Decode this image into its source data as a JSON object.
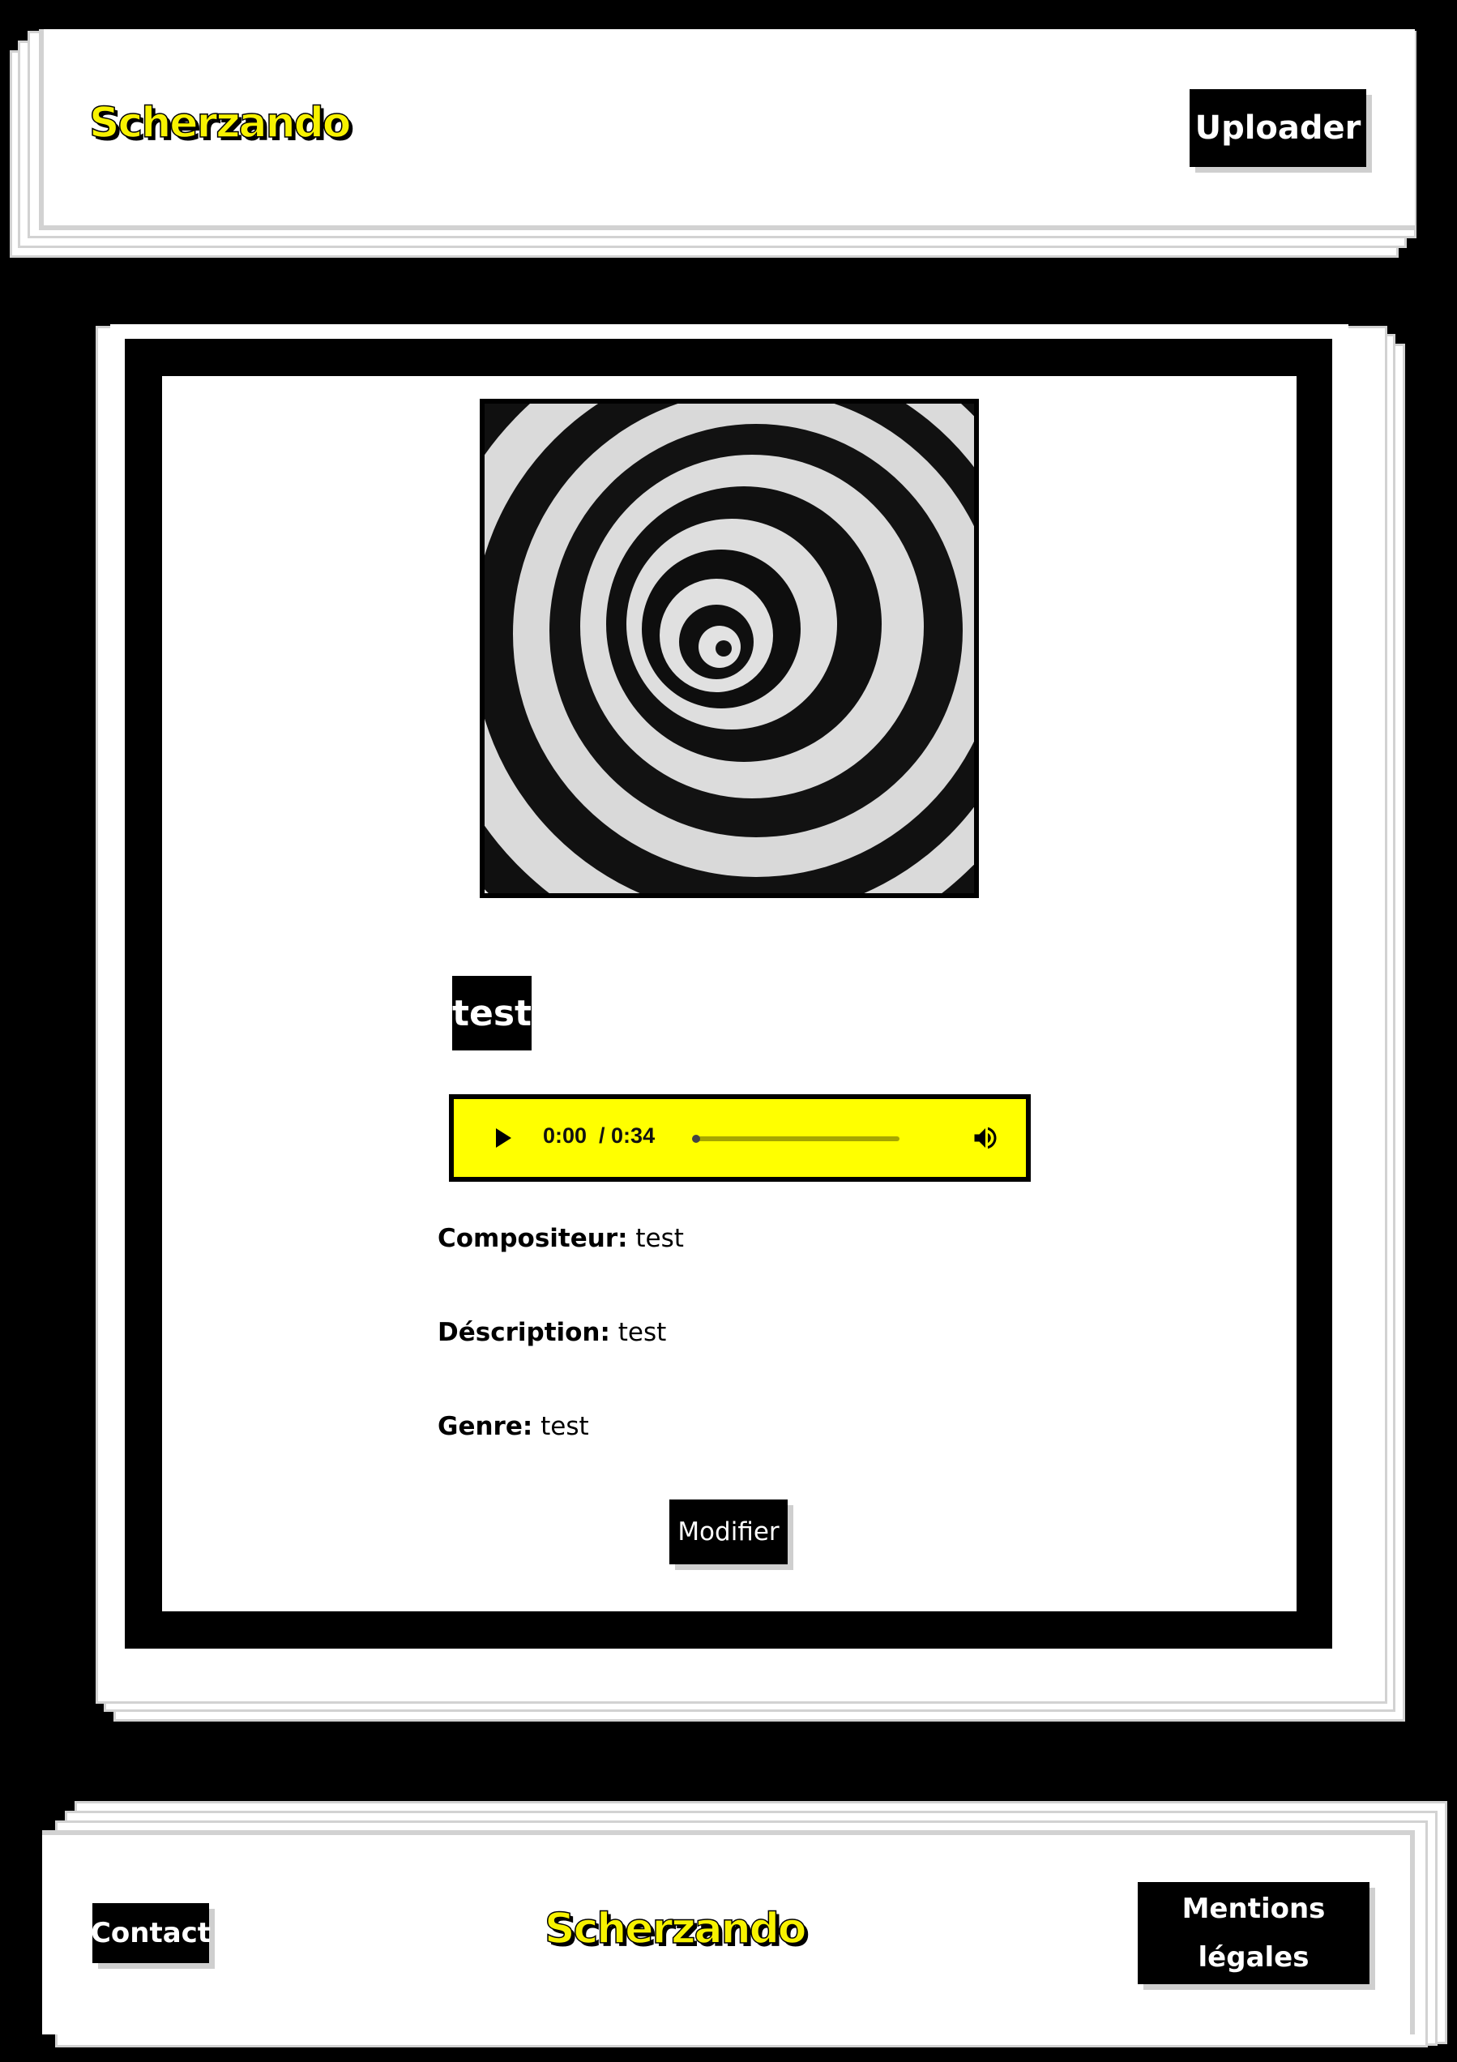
{
  "header": {
    "logo_text": "Scherzando",
    "upload_label": "Uploader"
  },
  "track": {
    "cover_icon": "spiral-optical-illusion-image",
    "title": "test",
    "player": {
      "current_time": "0:00",
      "duration": "0:34",
      "time_display": "0:00  / 0:34",
      "progress": 0,
      "play_icon": "play-icon",
      "volume_icon": "volume-icon"
    },
    "composer_label": "Compositeur:",
    "composer_value": "test",
    "description_label": "Déscription:",
    "description_value": "test",
    "genre_label": "Genre:",
    "genre_value": "test",
    "modify_label": "Modifier"
  },
  "footer": {
    "contact_label": "Contact",
    "logo_text": "Scherzando",
    "legal_label": "Mentions légales"
  },
  "colors": {
    "background": "#000000",
    "accent": "#ffff00",
    "card": "#ffffff",
    "shadow": "#d2d2d2"
  }
}
